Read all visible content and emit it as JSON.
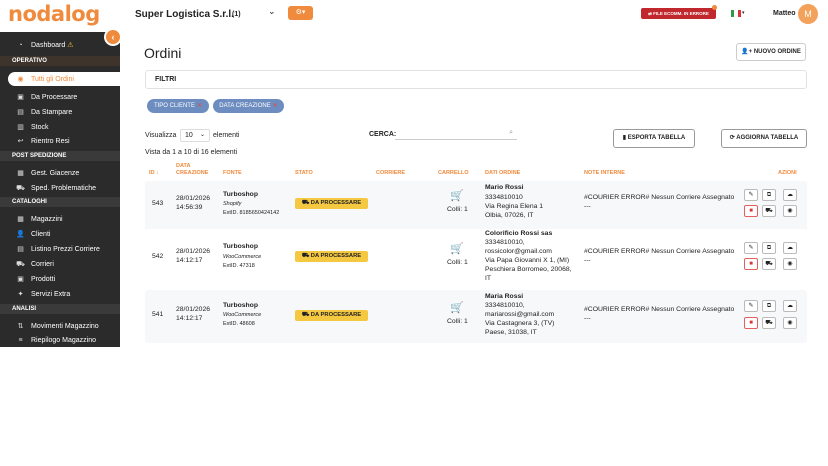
{
  "brand": {
    "logo": "nodalog",
    "accent": "#f08a3c"
  },
  "topbar": {
    "company": "Super Logistica S.r.l.",
    "company_count": "(1)",
    "error_button": "FILE ECOMM. IN ERRORE",
    "user_name": "Matteo",
    "avatar_initial": "M"
  },
  "sidebar": {
    "dashboard": "Dashboard",
    "sections": [
      "OPERATIVO",
      "POST SPEDIZIONE",
      "CATALOGHI",
      "ANALISI"
    ],
    "operativo": [
      "Tutti gli Ordini",
      "Da Processare",
      "Da Stampare",
      "Stock",
      "Rientro Resi"
    ],
    "post_spedizione": [
      "Gest. Giacenze",
      "Sped. Problematiche"
    ],
    "cataloghi": [
      "Magazzini",
      "Clienti",
      "Listino Prezzi Corriere",
      "Corrieri",
      "Prodotti",
      "Servizi Extra"
    ],
    "analisi": [
      "Movimenti Magazzino",
      "Riepilogo Magazzino"
    ]
  },
  "main": {
    "title": "Ordini",
    "new_order": "NUOVO ORDINE",
    "filters_title": "FILTRI",
    "chips": [
      "TIPO CLIENTE",
      "DATA CREAZIONE"
    ],
    "show_label": "Visualizza",
    "page_size": "10",
    "elements_label": "elementi",
    "search_label": "CERCA:",
    "search_value": "",
    "export_button": "ESPORTA TABELLA",
    "refresh_button": "AGGIORNA TABELLA",
    "showing": "Vista da 1 a 10 di 16 elementi"
  },
  "table": {
    "headers": {
      "id": "ID",
      "creation": "DATA CREAZIONE",
      "source": "FONTE",
      "status": "STATO",
      "courier": "CORRIERE",
      "cart": "CARRELLO",
      "order_data": "DATI ORDINE",
      "notes": "NOTE INTERNE",
      "actions": "AZIONI"
    },
    "rows": [
      {
        "id": "543",
        "date": "28/01/2026",
        "time": "14:56:39",
        "source_name": "Turboshop",
        "source_platform": "Shopify",
        "source_ext": "ExtID. 8185650424142",
        "status": "DA PROCESSARE",
        "colli": "Colli: 1",
        "order_lines": [
          "Mario Rossi",
          "3334810010",
          "Via Regina Elena 1",
          "Olbia, 07026, IT"
        ],
        "note": "#COURIER ERROR# Nessun Corriere Assegnato",
        "note_extra": "---"
      },
      {
        "id": "542",
        "date": "28/01/2026",
        "time": "14:12:17",
        "source_name": "Turboshop",
        "source_platform": "WooCommerce",
        "source_ext": "ExtID. 47318",
        "status": "DA PROCESSARE",
        "colli": "Colli: 1",
        "order_lines": [
          "Colorificio Rossi sas",
          "3334810010,",
          "rossicolor@gmail.com",
          "Via Papa Giovanni X 1, (MI)",
          "Peschiera Borromeo, 20068,",
          "IT"
        ],
        "note": "#COURIER ERROR# Nessun Corriere Assegnato",
        "note_extra": "---"
      },
      {
        "id": "541",
        "date": "28/01/2026",
        "time": "14:12:17",
        "source_name": "Turboshop",
        "source_platform": "WooCommerce",
        "source_ext": "ExtID. 48608",
        "status": "DA PROCESSARE",
        "colli": "Colli: 1",
        "order_lines": [
          "Maria Rossi",
          "3334810010,",
          "mariarossi@gmail.com",
          "Via Castagnera 3, (TV)",
          "Paese, 31038, IT"
        ],
        "note": "#COURIER ERROR# Nessun Corriere Assegnato",
        "note_extra": "---"
      }
    ]
  }
}
